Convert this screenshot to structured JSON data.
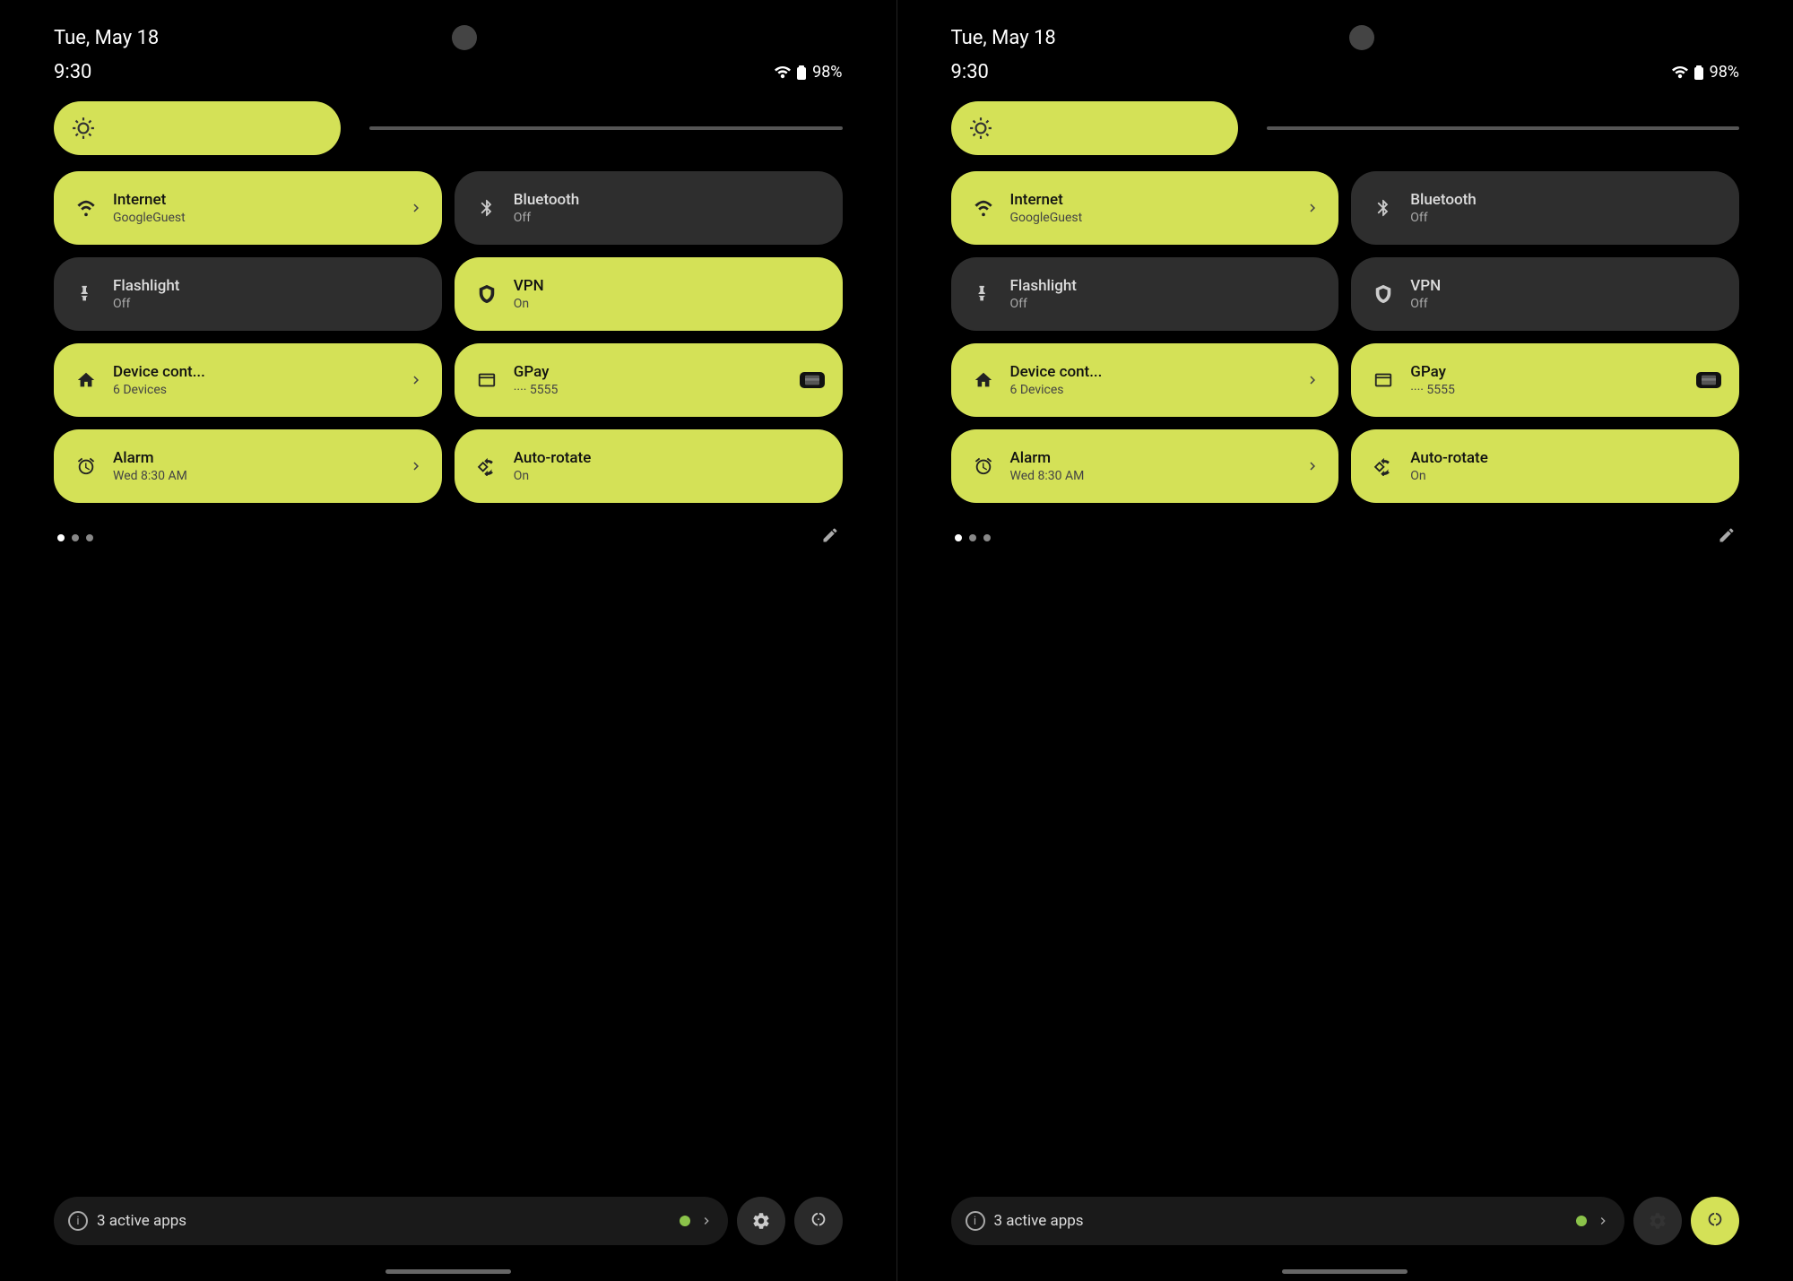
{
  "panels": [
    {
      "id": "left",
      "date": "Tue, May 18",
      "time": "9:30",
      "battery": "98%",
      "brightness": {
        "icon": "⚙"
      },
      "tiles": [
        {
          "id": "internet",
          "label": "Internet",
          "sub": "GoogleGuest",
          "icon": "wifi",
          "active": true,
          "hasChevron": true
        },
        {
          "id": "bluetooth",
          "label": "Bluetooth",
          "sub": "Off",
          "icon": "bluetooth",
          "active": false,
          "hasChevron": false
        },
        {
          "id": "flashlight",
          "label": "Flashlight",
          "sub": "Off",
          "icon": "flashlight",
          "active": false,
          "hasChevron": false
        },
        {
          "id": "vpn",
          "label": "VPN",
          "sub": "On",
          "icon": "vpn",
          "active": true,
          "hasChevron": false
        },
        {
          "id": "device",
          "label": "Device cont...",
          "sub": "6 Devices",
          "icon": "home",
          "active": true,
          "hasChevron": true
        },
        {
          "id": "gpay",
          "label": "GPay",
          "sub": "···· 5555",
          "icon": "gpay",
          "active": true,
          "hasChevron": false,
          "hasCard": true
        },
        {
          "id": "alarm",
          "label": "Alarm",
          "sub": "Wed 8:30 AM",
          "icon": "alarm",
          "active": true,
          "hasChevron": true
        },
        {
          "id": "autorotate",
          "label": "Auto-rotate",
          "sub": "On",
          "icon": "autorotate",
          "active": true,
          "hasChevron": false
        }
      ],
      "dots": [
        true,
        false,
        false
      ],
      "activeApps": "3 active apps",
      "powerActive": false
    },
    {
      "id": "right",
      "date": "Tue, May 18",
      "time": "9:30",
      "battery": "98%",
      "brightness": {
        "icon": "⚙"
      },
      "tiles": [
        {
          "id": "internet",
          "label": "Internet",
          "sub": "GoogleGuest",
          "icon": "wifi",
          "active": true,
          "hasChevron": true
        },
        {
          "id": "bluetooth",
          "label": "Bluetooth",
          "sub": "Off",
          "icon": "bluetooth",
          "active": false,
          "hasChevron": false
        },
        {
          "id": "flashlight",
          "label": "Flashlight",
          "sub": "Off",
          "icon": "flashlight",
          "active": false,
          "hasChevron": false
        },
        {
          "id": "vpn",
          "label": "VPN",
          "sub": "Off",
          "icon": "vpn",
          "active": false,
          "hasChevron": false
        },
        {
          "id": "device",
          "label": "Device cont...",
          "sub": "6 Devices",
          "icon": "home",
          "active": true,
          "hasChevron": true
        },
        {
          "id": "gpay",
          "label": "GPay",
          "sub": "···· 5555",
          "icon": "gpay",
          "active": true,
          "hasChevron": false,
          "hasCard": true
        },
        {
          "id": "alarm",
          "label": "Alarm",
          "sub": "Wed 8:30 AM",
          "icon": "alarm",
          "active": true,
          "hasChevron": true
        },
        {
          "id": "autorotate",
          "label": "Auto-rotate",
          "sub": "On",
          "icon": "autorotate",
          "active": true,
          "hasChevron": false
        }
      ],
      "dots": [
        true,
        false,
        false
      ],
      "activeApps": "3 active apps",
      "powerActive": true
    }
  ],
  "icons": {
    "wifi": "▼",
    "bluetooth": "✱",
    "flashlight": "🔦",
    "vpn": "🛡",
    "home": "⌂",
    "gpay": "💳",
    "alarm": "⏰",
    "autorotate": "↻",
    "edit": "✏",
    "info": "i",
    "settings": "⚙",
    "power": "⏻",
    "battery": "🔋",
    "signal": "▲"
  }
}
